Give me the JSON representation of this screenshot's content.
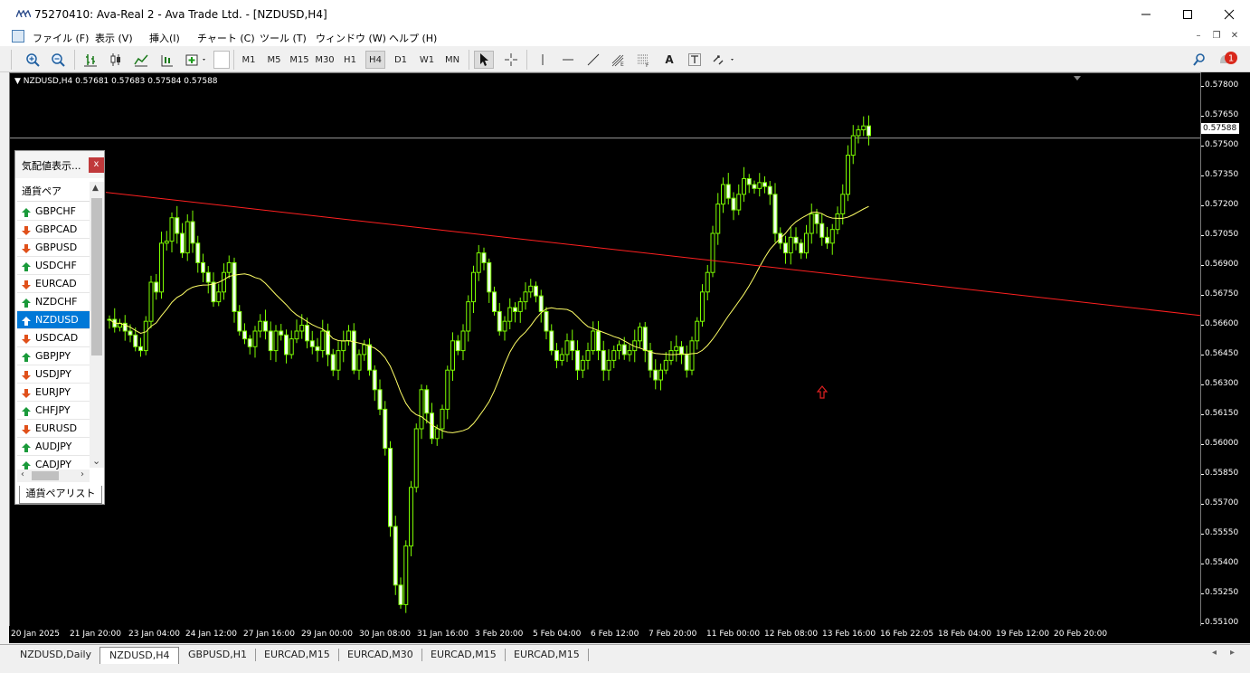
{
  "window": {
    "title": "75270410: Ava-Real 2 - Ava Trade Ltd. - [NZDUSD,H4]"
  },
  "menu": [
    "ファイル (F)",
    "表示 (V)",
    "挿入(I)",
    "チャート (C)",
    "ツール (T)",
    "ウィンドウ (W)",
    "ヘルプ (H)"
  ],
  "toolbar": {
    "timeframes": [
      "M1",
      "M5",
      "M15",
      "M30",
      "H1",
      "H4",
      "D1",
      "W1",
      "MN"
    ],
    "active_timeframe": "H4",
    "notification_count": "1"
  },
  "chart": {
    "info": "NZDUSD,H4  0.57681 0.57683 0.57584 0.57588",
    "current_price": "0.57588",
    "price_ticks": [
      "0.57800",
      "0.57650",
      "0.57500",
      "0.57350",
      "0.57200",
      "0.57050",
      "0.56900",
      "0.56750",
      "0.56600",
      "0.56450",
      "0.56300",
      "0.56150",
      "0.56000",
      "0.55850",
      "0.55700",
      "0.55550",
      "0.55400",
      "0.55250",
      "0.55100"
    ],
    "time_ticks": [
      "20 Jan 2025",
      "21 Jan 20:00",
      "23 Jan 04:00",
      "24 Jan 12:00",
      "27 Jan 16:00",
      "29 Jan 00:00",
      "30 Jan 08:00",
      "31 Jan 16:00",
      "3 Feb 20:00",
      "5 Feb 04:00",
      "6 Feb 12:00",
      "7 Feb 20:00",
      "11 Feb 00:00",
      "12 Feb 08:00",
      "13 Feb 16:00",
      "16 Feb 22:05",
      "18 Feb 04:00",
      "19 Feb 12:00",
      "20 Feb 20:00"
    ],
    "colors": {
      "background": "#000000",
      "candle": "#7CFC00",
      "candle_up_fill": "#000000",
      "candle_down_fill": "#F0FFF0",
      "ma": "#FFFF66",
      "trendline": "#FF2020",
      "arrow": "#E02020",
      "price_line": "#9a9a9a"
    }
  },
  "chart_data": {
    "type": "candlestick",
    "symbol": "NZDUSD",
    "timeframe": "H4",
    "ylim": [
      0.551,
      0.5785
    ],
    "ohlc_closes": [
      0.5666,
      0.5662,
      0.5664,
      0.566,
      0.5658,
      0.5652,
      0.565,
      0.5665,
      0.5685,
      0.568,
      0.5705,
      0.5706,
      0.5718,
      0.571,
      0.57,
      0.5716,
      0.5705,
      0.5695,
      0.569,
      0.5685,
      0.5675,
      0.568,
      0.569,
      0.5695,
      0.567,
      0.566,
      0.5656,
      0.5652,
      0.566,
      0.5665,
      0.566,
      0.565,
      0.566,
      0.5658,
      0.5648,
      0.5656,
      0.566,
      0.5663,
      0.5655,
      0.5652,
      0.565,
      0.566,
      0.5648,
      0.564,
      0.565,
      0.5655,
      0.566,
      0.564,
      0.5648,
      0.5653,
      0.564,
      0.563,
      0.562,
      0.56,
      0.556,
      0.553,
      0.552,
      0.555,
      0.558,
      0.561,
      0.563,
      0.5618,
      0.5605,
      0.561,
      0.562,
      0.564,
      0.5655,
      0.565,
      0.566,
      0.5675,
      0.569,
      0.57,
      0.5695,
      0.568,
      0.567,
      0.566,
      0.5665,
      0.5672,
      0.567,
      0.5675,
      0.568,
      0.5683,
      0.5678,
      0.567,
      0.566,
      0.565,
      0.5645,
      0.5648,
      0.5655,
      0.565,
      0.564,
      0.5645,
      0.565,
      0.566,
      0.565,
      0.564,
      0.5645,
      0.565,
      0.5653,
      0.5648,
      0.565,
      0.5655,
      0.5662,
      0.565,
      0.564,
      0.5635,
      0.564,
      0.5645,
      0.565,
      0.5652,
      0.5648,
      0.564,
      0.5655,
      0.5665,
      0.568,
      0.569,
      0.571,
      0.5725,
      0.5735,
      0.5728,
      0.5722,
      0.573,
      0.5738,
      0.5735,
      0.5733,
      0.5736,
      0.5734,
      0.573,
      0.571,
      0.5705,
      0.57,
      0.5708,
      0.5705,
      0.57,
      0.571,
      0.572,
      0.5715,
      0.5708,
      0.5705,
      0.5712,
      0.572,
      0.573,
      0.575,
      0.576,
      0.5763,
      0.5765,
      0.576
    ]
  },
  "market_watch": {
    "title": "気配値表示...",
    "column_header": "通貨ペア",
    "tab_label": "通貨ペアリスト",
    "rows": [
      {
        "symbol": "GBPCHF",
        "dir": "up"
      },
      {
        "symbol": "GBPCAD",
        "dir": "down"
      },
      {
        "symbol": "GBPUSD",
        "dir": "down"
      },
      {
        "symbol": "USDCHF",
        "dir": "up"
      },
      {
        "symbol": "EURCAD",
        "dir": "down"
      },
      {
        "symbol": "NZDCHF",
        "dir": "up"
      },
      {
        "symbol": "NZDUSD",
        "dir": "up",
        "selected": true
      },
      {
        "symbol": "USDCAD",
        "dir": "down"
      },
      {
        "symbol": "GBPJPY",
        "dir": "up"
      },
      {
        "symbol": "USDJPY",
        "dir": "down"
      },
      {
        "symbol": "EURJPY",
        "dir": "down"
      },
      {
        "symbol": "CHFJPY",
        "dir": "up"
      },
      {
        "symbol": "EURUSD",
        "dir": "down"
      },
      {
        "symbol": "AUDJPY",
        "dir": "up"
      },
      {
        "symbol": "CADJPY",
        "dir": "up"
      }
    ]
  },
  "bottom_tabs": [
    {
      "label": "NZDUSD,Daily",
      "active": false
    },
    {
      "label": "NZDUSD,H4",
      "active": true
    },
    {
      "label": "GBPUSD,H1",
      "active": false
    },
    {
      "label": "EURCAD,M15",
      "active": false
    },
    {
      "label": "EURCAD,M30",
      "active": false
    },
    {
      "label": "EURCAD,M15",
      "active": false
    },
    {
      "label": "EURCAD,M15",
      "active": false
    }
  ]
}
